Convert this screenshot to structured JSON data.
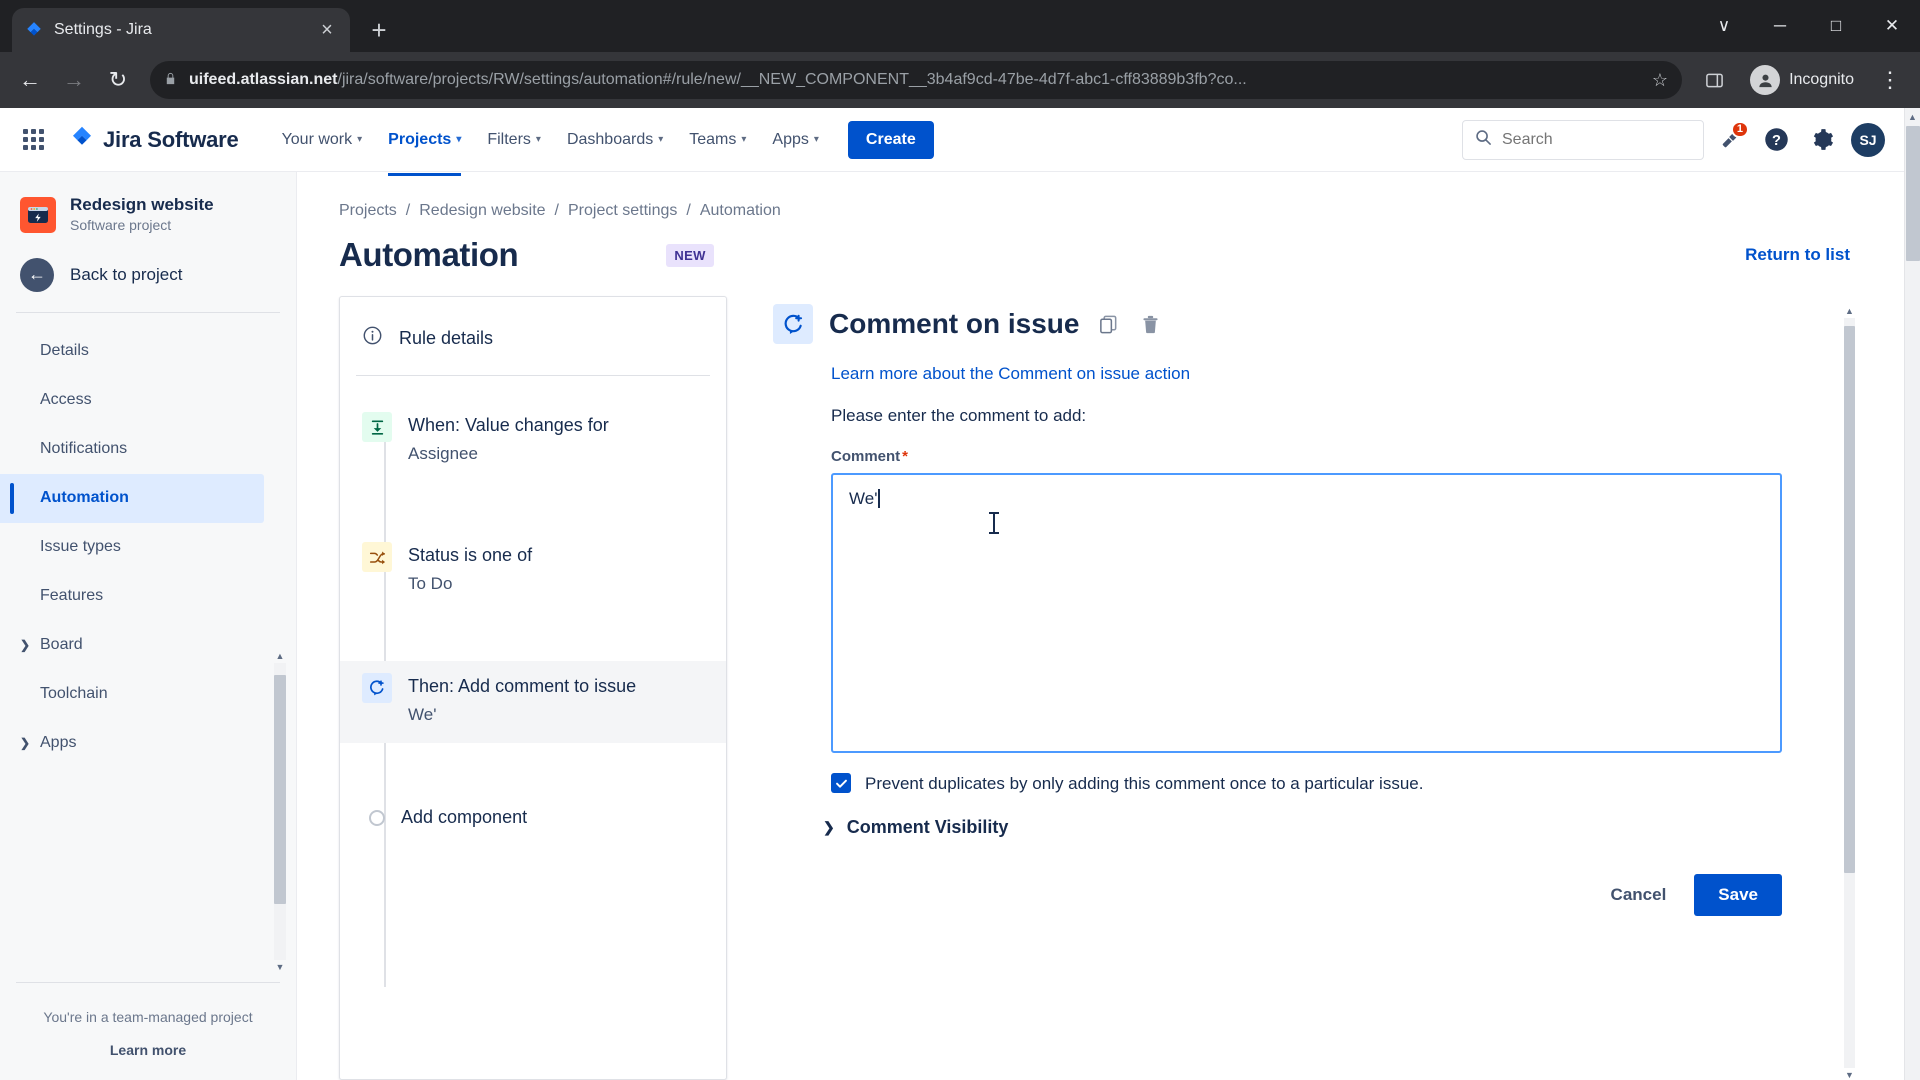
{
  "browser": {
    "tab": {
      "title": "Settings - Jira",
      "favicon": "jira-favicon",
      "close": "×"
    },
    "new_tab_label": "+",
    "window_controls": {
      "minimize_chevron": "∨",
      "minimize": "─",
      "maximize": "□",
      "close": "✕"
    },
    "nav": {
      "back": "←",
      "forward": "→",
      "reload": "↻"
    },
    "url": {
      "scheme_icon": "lock-icon",
      "host": "uifeed.atlassian.net",
      "path": "/jira/software/projects/RW/settings/automation#/rule/new/__NEW_COMPONENT__3b4af9cd-47be-4d7f-abc1-cff83889b3fb?co...",
      "star": "☆"
    },
    "incognito_label": "Incognito",
    "menu": "⋮"
  },
  "topnav": {
    "brand": "Jira Software",
    "items": [
      {
        "label": "Your work",
        "has_caret": true,
        "active": false
      },
      {
        "label": "Projects",
        "has_caret": true,
        "active": true
      },
      {
        "label": "Filters",
        "has_caret": true,
        "active": false
      },
      {
        "label": "Dashboards",
        "has_caret": true,
        "active": false
      },
      {
        "label": "Teams",
        "has_caret": true,
        "active": false
      },
      {
        "label": "Apps",
        "has_caret": true,
        "active": false
      }
    ],
    "create_label": "Create",
    "search_placeholder": "Search",
    "notification_count": "1",
    "avatar_initials": "SJ"
  },
  "sidebar": {
    "project_name": "Redesign website",
    "project_type": "Software project",
    "back_label": "Back to project",
    "items": [
      {
        "label": "Details",
        "selected": false,
        "expandable": false
      },
      {
        "label": "Access",
        "selected": false,
        "expandable": false
      },
      {
        "label": "Notifications",
        "selected": false,
        "expandable": false
      },
      {
        "label": "Automation",
        "selected": true,
        "expandable": false
      },
      {
        "label": "Issue types",
        "selected": false,
        "expandable": false
      },
      {
        "label": "Features",
        "selected": false,
        "expandable": false
      },
      {
        "label": "Board",
        "selected": false,
        "expandable": true
      },
      {
        "label": "Toolchain",
        "selected": false,
        "expandable": false
      },
      {
        "label": "Apps",
        "selected": false,
        "expandable": true
      }
    ],
    "footer_note": "You're in a team-managed project",
    "footer_link": "Learn more"
  },
  "breadcrumb": [
    {
      "label": "Projects"
    },
    {
      "label": "Redesign website"
    },
    {
      "label": "Project settings"
    },
    {
      "label": "Automation"
    }
  ],
  "breadcrumb_sep": "/",
  "header": {
    "title": "Automation",
    "badge": "NEW",
    "return_link": "Return to list"
  },
  "rule": {
    "details_label": "Rule details",
    "steps": [
      {
        "title": "When: Value changes for",
        "subtitle": "Assignee",
        "icon": "trigger-icon",
        "selected": false
      },
      {
        "title": "Status is one of",
        "subtitle": "To Do",
        "icon": "condition-icon",
        "selected": false
      },
      {
        "title": "Then: Add comment to issue",
        "subtitle": "We'",
        "icon": "action-comment-icon",
        "selected": true
      }
    ],
    "add_component_label": "Add component"
  },
  "detail": {
    "title": "Comment on issue",
    "copy_icon": "copy-icon",
    "delete_icon": "trash-icon",
    "learn_more": "Learn more about the Comment on issue action",
    "instruction": "Please enter the comment to add:",
    "comment_field_label": "Comment",
    "required_mark": "*",
    "comment_value": "We'",
    "prevent_duplicates_label": "Prevent duplicates by only adding this comment once to a particular issue.",
    "prevent_duplicates_checked": true,
    "comment_visibility_label": "Comment Visibility",
    "cancel_label": "Cancel",
    "save_label": "Save"
  },
  "colors": {
    "accent": "#0052cc",
    "badge_new_bg": "#e9e2fc",
    "badge_new_fg": "#403294",
    "notification_red": "#de350b",
    "project_icon": "#ff5630",
    "trigger_bg": "#e3fcef",
    "condition_bg": "#fff7d6",
    "action_bg": "#deebff"
  }
}
